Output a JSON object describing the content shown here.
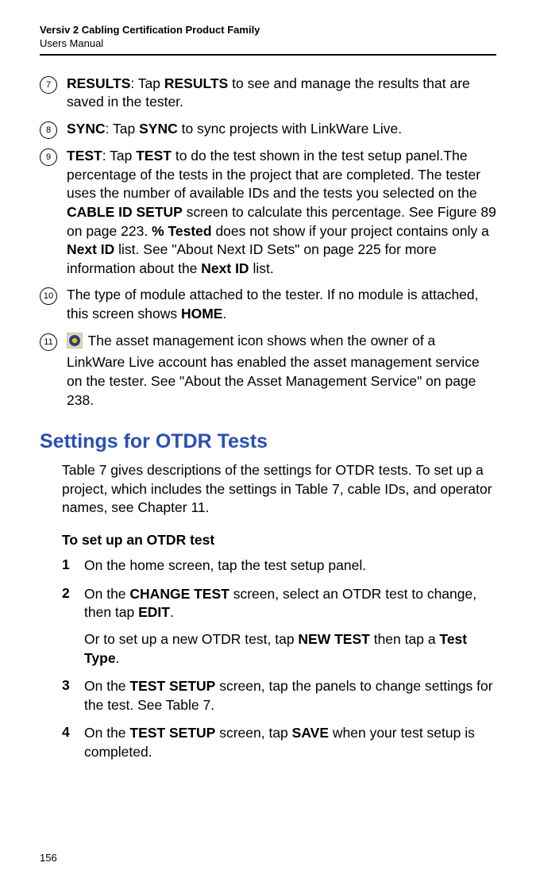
{
  "header": {
    "title": "Versiv 2 Cabling Certification Product Family",
    "subtitle": "Users Manual"
  },
  "items": [
    {
      "num": "7",
      "lead_bold": "RESULTS",
      "sep": ": Tap ",
      "bold2": "RESULTS",
      "rest": " to see and manage the results that are saved in the tester."
    },
    {
      "num": "8",
      "lead_bold": "SYNC",
      "sep": ": Tap ",
      "bold2": "SYNC",
      "rest": " to sync projects with LinkWare Live."
    },
    {
      "num": "9",
      "lead_bold": "TEST",
      "sep": ": Tap ",
      "bold2": "TEST",
      "t1": " to do the test shown in the test setup panel.The percentage of the tests in the project that are completed. The tester uses the number of available IDs and the tests you selected on the ",
      "bold3": "CABLE ID SETUP",
      "t2": " screen to calculate this percentage. See Figure 89 on page 223. ",
      "bold4": "% Tested",
      "t3": " does not show if your project contains only a ",
      "bold5": "Next ID",
      "t4": " list. See \"About Next ID Sets\" on page 225 for more information about the ",
      "bold6": "Next ID",
      "t5": " list."
    },
    {
      "num": "10",
      "t1": "The type of module attached to the tester. If no module is attached, this screen shows ",
      "bold1": "HOME",
      "t2": "."
    },
    {
      "num": "11",
      "t1": " The asset management icon shows when the owner of a LinkWare Live account has enabled the asset management service on the tester. See \"About the Asset Management Service\" on page 238."
    }
  ],
  "section_heading": "Settings for OTDR Tests",
  "intro": "Table 7 gives descriptions of the settings for OTDR tests. To set up a project, which includes the settings in Table 7, cable IDs, and operator names, see Chapter 11.",
  "procedure_title": "To set up an OTDR test",
  "steps": {
    "s1": "On the home screen, tap the test setup panel.",
    "s2a": "On the ",
    "s2b": "CHANGE TEST",
    "s2c": " screen, select an OTDR test to change, then tap ",
    "s2d": "EDIT",
    "s2e": ".",
    "s2f": "Or to set up a new OTDR test, tap ",
    "s2g": "NEW TEST",
    "s2h": " then tap a ",
    "s2i": "Test Type",
    "s2j": ".",
    "s3a": "On the ",
    "s3b": "TEST SETUP",
    "s3c": " screen, tap the panels to change settings for the test. See Table 7.",
    "s4a": "On the ",
    "s4b": "TEST SETUP",
    "s4c": " screen, tap ",
    "s4d": "SAVE",
    "s4e": " when your test setup is completed."
  },
  "page_number": "156"
}
